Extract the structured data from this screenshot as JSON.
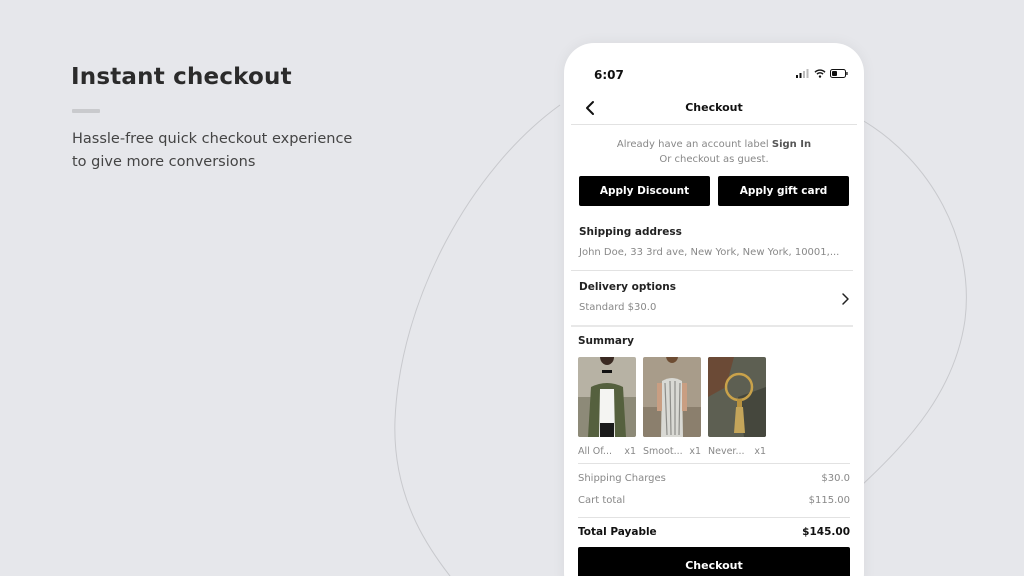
{
  "hero": {
    "title": "Instant checkout",
    "subtitle_line1": "Hassle-free quick checkout experience",
    "subtitle_line2": "to give more conversions"
  },
  "status_bar": {
    "time": "6:07",
    "icons": [
      "signal-icon",
      "wifi-icon",
      "battery-icon"
    ]
  },
  "nav": {
    "title": "Checkout",
    "back_icon": "chevron-left-icon"
  },
  "account": {
    "prefix": "Already have an account label ",
    "sign_in": "Sign In",
    "guest": "Or checkout as guest."
  },
  "actions": {
    "apply_discount": "Apply Discount",
    "apply_gift_card": "Apply gift card"
  },
  "shipping": {
    "label": "Shipping address",
    "value": "John Doe, 33 3rd ave, New York, New York, 10001,..."
  },
  "delivery": {
    "label": "Delivery options",
    "value": "Standard $30.0",
    "icon": "chevron-right-icon"
  },
  "summary": {
    "label": "Summary",
    "items": [
      {
        "name": "All Of...",
        "qty": "x1"
      },
      {
        "name": "Smoot...",
        "qty": "x1"
      },
      {
        "name": "Never...",
        "qty": "x1"
      }
    ],
    "shipping_charges_label": "Shipping Charges",
    "shipping_charges_value": "$30.0",
    "cart_total_label": "Cart total",
    "cart_total_value": "$115.00",
    "total_label": "Total Payable",
    "total_value": "$145.00"
  },
  "checkout_button": "Checkout",
  "colors": {
    "background": "#e6e7eb",
    "primary_button": "#000000",
    "muted_text": "#888888"
  }
}
